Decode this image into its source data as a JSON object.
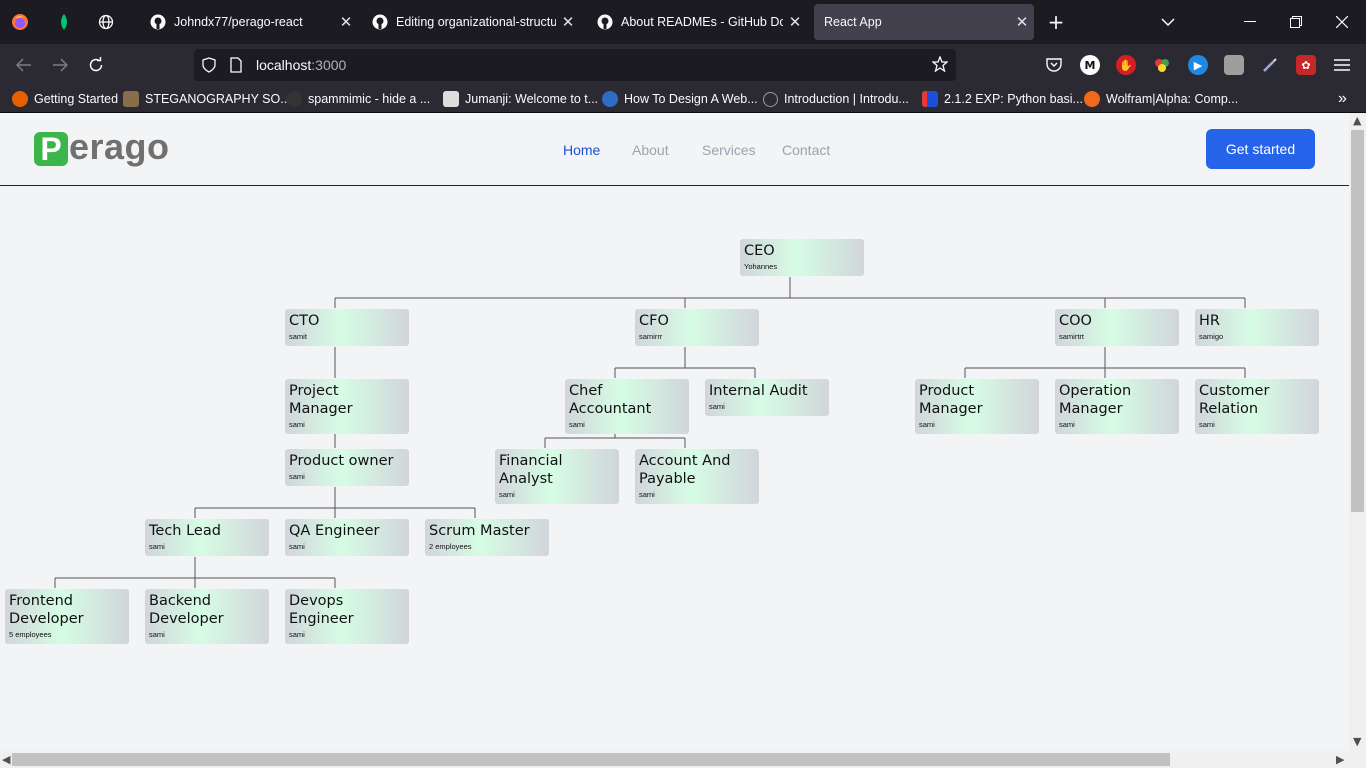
{
  "browser": {
    "tabs": [
      {
        "title": "Johndx77/perago-react",
        "favicon": "github-icon",
        "active": false
      },
      {
        "title": "Editing organizational-structure",
        "favicon": "github-icon",
        "active": false
      },
      {
        "title": "About READMEs - GitHub Docs",
        "favicon": "github-icon",
        "active": false
      },
      {
        "title": "React App",
        "favicon": "react-icon",
        "active": true
      }
    ],
    "url_host": "localhost",
    "url_port": ":3000",
    "bookmarks": [
      {
        "label": "Getting Started",
        "icon": "firefox-icon",
        "color": "#e66000"
      },
      {
        "label": "STEGANOGRAPHY SO...",
        "icon": "photo-icon",
        "color": "#8a6d4b"
      },
      {
        "label": "spammimic - hide a ...",
        "icon": "spam-icon",
        "color": "#333333"
      },
      {
        "label": "Jumanji: Welcome to t...",
        "icon": "movie-icon",
        "color": "#dddddd"
      },
      {
        "label": "How To Design A Web...",
        "icon": "wordpress-icon",
        "color": "#2d6ec4"
      },
      {
        "label": "Introduction | Introdu...",
        "icon": "globe-icon",
        "color": "#9a9aa0"
      },
      {
        "label": "2.1.2 EXP: Python basi...",
        "icon": "bookmark-icon",
        "color": "#1e4fd8"
      },
      {
        "label": "Wolfram|Alpha: Comp...",
        "icon": "wolfram-icon",
        "color": "#f06a1d"
      }
    ]
  },
  "site": {
    "logo_first": "P",
    "logo_rest": "erago",
    "nav": [
      "Home",
      "About",
      "Services",
      "Contact"
    ],
    "active_nav": "Home",
    "cta": "Get started"
  },
  "org": {
    "ceo": {
      "title": "CEO",
      "sub": "Yohannes"
    },
    "cto": {
      "title": "CTO",
      "sub": "samit"
    },
    "cfo": {
      "title": "CFO",
      "sub": "samirrr"
    },
    "coo": {
      "title": "COO",
      "sub": "samirtrt"
    },
    "hr": {
      "title": "HR",
      "sub": "samigo"
    },
    "project_manager": {
      "title": "Project Manager",
      "sub": "sami"
    },
    "chef_accountant": {
      "title": "Chef Accountant",
      "sub": "sami"
    },
    "internal_audit": {
      "title": "Internal Audit",
      "sub": "sami"
    },
    "product_manager": {
      "title": "Product Manager",
      "sub": "sami"
    },
    "operation_manager": {
      "title": "Operation Manager",
      "sub": "sami"
    },
    "customer_relation": {
      "title": "Customer Relation",
      "sub": "sami"
    },
    "product_owner": {
      "title": "Product owner",
      "sub": "sami"
    },
    "financial_analyst": {
      "title": "Financial Analyst",
      "sub": "sami"
    },
    "account_payable": {
      "title": "Account And Payable",
      "sub": "sami"
    },
    "tech_lead": {
      "title": "Tech Lead",
      "sub": "sami"
    },
    "qa_engineer": {
      "title": "QA Engineer",
      "sub": "sami"
    },
    "scrum_master": {
      "title": "Scrum Master",
      "sub": "2 employees"
    },
    "frontend_dev": {
      "title": "Frontend Developer",
      "sub": "5 employees"
    },
    "backend_dev": {
      "title": "Backend Developer",
      "sub": "sami"
    },
    "devops": {
      "title": "Devops Engineer",
      "sub": "sami"
    }
  }
}
